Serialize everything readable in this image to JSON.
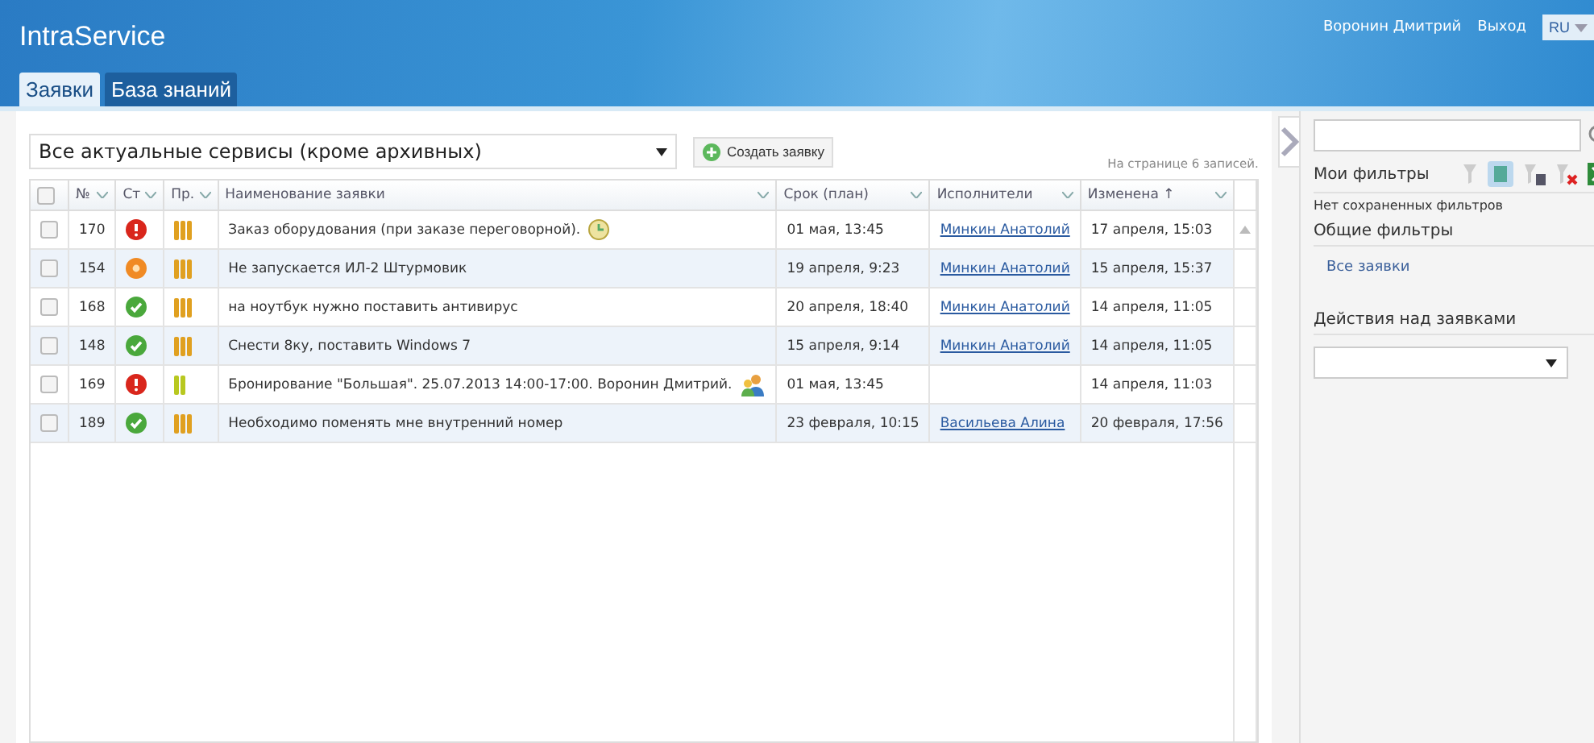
{
  "header": {
    "logo": "IntraService",
    "user": "Воронин Дмитрий",
    "logout": "Выход",
    "language": "RU"
  },
  "tabs": [
    {
      "label": "Заявки",
      "selected": true
    },
    {
      "label": "База знаний",
      "selected": false
    }
  ],
  "toolbar": {
    "service_filter": "Все актуальные сервисы (кроме архивных)",
    "create_button": "Создать заявку",
    "page_info": "На странице 6 записей."
  },
  "table": {
    "select_all_checked": false,
    "columns": [
      "№",
      "Ст",
      "Пр.",
      "Наименование заявки",
      "Срок (план)",
      "Исполнители",
      "Изменена ↑"
    ],
    "rows": [
      {
        "checked": false,
        "number": "170",
        "status": {
          "kind": "critical"
        },
        "priority": {
          "kind": "high"
        },
        "title": "Заказ оборудования (при заказе переговорной).",
        "attachment": {
          "kind": "clock"
        },
        "due": "01 мая, 13:45",
        "assignee": "Минкин Анатолий",
        "changed": "17 апреля, 15:03"
      },
      {
        "checked": false,
        "number": "154",
        "status": {
          "kind": "in_progress"
        },
        "priority": {
          "kind": "high"
        },
        "title": "Не запускается ИЛ-2 Штурмовик",
        "due": "19 апреля, 9:23",
        "assignee": "Минкин Анатолий",
        "changed": "15 апреля, 15:37"
      },
      {
        "checked": false,
        "number": "168",
        "status": {
          "kind": "done"
        },
        "priority": {
          "kind": "high"
        },
        "title": "на ноутбук нужно поставить антивирус",
        "due": "20 апреля, 18:40",
        "assignee": "Минкин Анатолий",
        "changed": "14 апреля, 11:05"
      },
      {
        "checked": false,
        "number": "148",
        "status": {
          "kind": "done"
        },
        "priority": {
          "kind": "high"
        },
        "title": "Снести 8ку, поставить Windows 7",
        "due": "15 апреля, 9:14",
        "assignee": "Минкин Анатолий",
        "changed": "14 апреля, 11:05"
      },
      {
        "checked": false,
        "number": "169",
        "status": {
          "kind": "critical"
        },
        "priority": {
          "kind": "medium"
        },
        "title": "Бронирование \"Большая\". 25.07.2013 14:00-17:00. Воронин Дмитрий.",
        "attachment": {
          "kind": "user"
        },
        "due": "01 мая, 13:45",
        "changed": "14 апреля, 11:03"
      },
      {
        "checked": false,
        "number": "189",
        "status": {
          "kind": "done"
        },
        "priority": {
          "kind": "high"
        },
        "title": "Необходимо поменять мне внутренний номер",
        "due": "23 февраля, 10:15",
        "assignee": "Васильева Алина",
        "changed": "20 февраля, 17:56"
      }
    ]
  },
  "sidebar": {
    "my_filters_title": "Мои фильтры",
    "no_filters": "Нет сохраненных фильтров",
    "common_filters_title": "Общие фильтры",
    "common_filters": [
      "Все заявки"
    ],
    "actions_title": "Действия над заявками"
  }
}
